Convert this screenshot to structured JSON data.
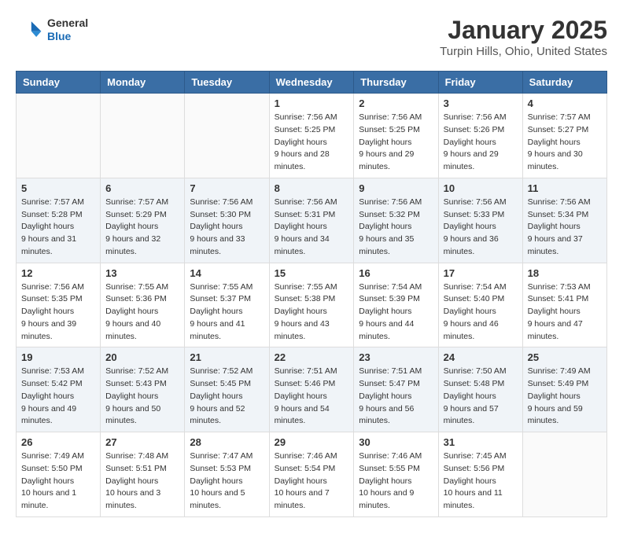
{
  "header": {
    "logo_general": "General",
    "logo_blue": "Blue",
    "month_title": "January 2025",
    "location": "Turpin Hills, Ohio, United States"
  },
  "weekdays": [
    "Sunday",
    "Monday",
    "Tuesday",
    "Wednesday",
    "Thursday",
    "Friday",
    "Saturday"
  ],
  "weeks": [
    [
      {
        "day": "",
        "empty": true
      },
      {
        "day": "",
        "empty": true
      },
      {
        "day": "",
        "empty": true
      },
      {
        "day": "1",
        "sunrise": "7:56 AM",
        "sunset": "5:25 PM",
        "daylight": "9 hours and 28 minutes."
      },
      {
        "day": "2",
        "sunrise": "7:56 AM",
        "sunset": "5:25 PM",
        "daylight": "9 hours and 29 minutes."
      },
      {
        "day": "3",
        "sunrise": "7:56 AM",
        "sunset": "5:26 PM",
        "daylight": "9 hours and 29 minutes."
      },
      {
        "day": "4",
        "sunrise": "7:57 AM",
        "sunset": "5:27 PM",
        "daylight": "9 hours and 30 minutes."
      }
    ],
    [
      {
        "day": "5",
        "sunrise": "7:57 AM",
        "sunset": "5:28 PM",
        "daylight": "9 hours and 31 minutes."
      },
      {
        "day": "6",
        "sunrise": "7:57 AM",
        "sunset": "5:29 PM",
        "daylight": "9 hours and 32 minutes."
      },
      {
        "day": "7",
        "sunrise": "7:56 AM",
        "sunset": "5:30 PM",
        "daylight": "9 hours and 33 minutes."
      },
      {
        "day": "8",
        "sunrise": "7:56 AM",
        "sunset": "5:31 PM",
        "daylight": "9 hours and 34 minutes."
      },
      {
        "day": "9",
        "sunrise": "7:56 AM",
        "sunset": "5:32 PM",
        "daylight": "9 hours and 35 minutes."
      },
      {
        "day": "10",
        "sunrise": "7:56 AM",
        "sunset": "5:33 PM",
        "daylight": "9 hours and 36 minutes."
      },
      {
        "day": "11",
        "sunrise": "7:56 AM",
        "sunset": "5:34 PM",
        "daylight": "9 hours and 37 minutes."
      }
    ],
    [
      {
        "day": "12",
        "sunrise": "7:56 AM",
        "sunset": "5:35 PM",
        "daylight": "9 hours and 39 minutes."
      },
      {
        "day": "13",
        "sunrise": "7:55 AM",
        "sunset": "5:36 PM",
        "daylight": "9 hours and 40 minutes."
      },
      {
        "day": "14",
        "sunrise": "7:55 AM",
        "sunset": "5:37 PM",
        "daylight": "9 hours and 41 minutes."
      },
      {
        "day": "15",
        "sunrise": "7:55 AM",
        "sunset": "5:38 PM",
        "daylight": "9 hours and 43 minutes."
      },
      {
        "day": "16",
        "sunrise": "7:54 AM",
        "sunset": "5:39 PM",
        "daylight": "9 hours and 44 minutes."
      },
      {
        "day": "17",
        "sunrise": "7:54 AM",
        "sunset": "5:40 PM",
        "daylight": "9 hours and 46 minutes."
      },
      {
        "day": "18",
        "sunrise": "7:53 AM",
        "sunset": "5:41 PM",
        "daylight": "9 hours and 47 minutes."
      }
    ],
    [
      {
        "day": "19",
        "sunrise": "7:53 AM",
        "sunset": "5:42 PM",
        "daylight": "9 hours and 49 minutes."
      },
      {
        "day": "20",
        "sunrise": "7:52 AM",
        "sunset": "5:43 PM",
        "daylight": "9 hours and 50 minutes."
      },
      {
        "day": "21",
        "sunrise": "7:52 AM",
        "sunset": "5:45 PM",
        "daylight": "9 hours and 52 minutes."
      },
      {
        "day": "22",
        "sunrise": "7:51 AM",
        "sunset": "5:46 PM",
        "daylight": "9 hours and 54 minutes."
      },
      {
        "day": "23",
        "sunrise": "7:51 AM",
        "sunset": "5:47 PM",
        "daylight": "9 hours and 56 minutes."
      },
      {
        "day": "24",
        "sunrise": "7:50 AM",
        "sunset": "5:48 PM",
        "daylight": "9 hours and 57 minutes."
      },
      {
        "day": "25",
        "sunrise": "7:49 AM",
        "sunset": "5:49 PM",
        "daylight": "9 hours and 59 minutes."
      }
    ],
    [
      {
        "day": "26",
        "sunrise": "7:49 AM",
        "sunset": "5:50 PM",
        "daylight": "10 hours and 1 minute."
      },
      {
        "day": "27",
        "sunrise": "7:48 AM",
        "sunset": "5:51 PM",
        "daylight": "10 hours and 3 minutes."
      },
      {
        "day": "28",
        "sunrise": "7:47 AM",
        "sunset": "5:53 PM",
        "daylight": "10 hours and 5 minutes."
      },
      {
        "day": "29",
        "sunrise": "7:46 AM",
        "sunset": "5:54 PM",
        "daylight": "10 hours and 7 minutes."
      },
      {
        "day": "30",
        "sunrise": "7:46 AM",
        "sunset": "5:55 PM",
        "daylight": "10 hours and 9 minutes."
      },
      {
        "day": "31",
        "sunrise": "7:45 AM",
        "sunset": "5:56 PM",
        "daylight": "10 hours and 11 minutes."
      },
      {
        "day": "",
        "empty": true
      }
    ]
  ],
  "labels": {
    "sunrise": "Sunrise:",
    "sunset": "Sunset:",
    "daylight": "Daylight hours"
  }
}
